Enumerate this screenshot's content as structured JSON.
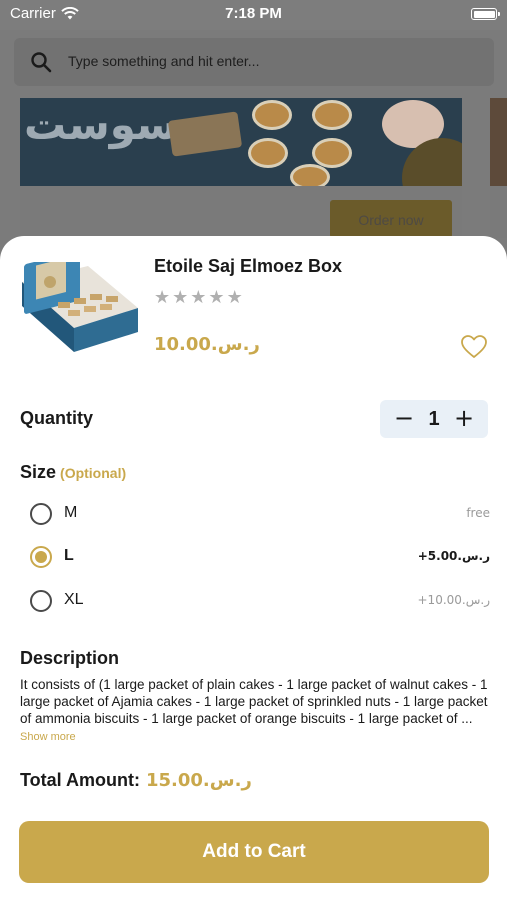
{
  "status_bar": {
    "carrier": "Carrier",
    "time": "7:18 PM"
  },
  "search": {
    "placeholder": "Type something and hit enter..."
  },
  "background": {
    "order_button": "Order now"
  },
  "product": {
    "title": "Etoile Saj Elmoez Box",
    "rating_stars": 5,
    "price": "10.00.ر.س"
  },
  "quantity": {
    "label": "Quantity",
    "value": "1",
    "minus": "−",
    "plus": "+"
  },
  "size": {
    "label": "Size",
    "optional": "(Optional)",
    "options": [
      {
        "name": "M",
        "price": "free",
        "selected": false
      },
      {
        "name": "L",
        "price": "+5.00.ر.س",
        "selected": true
      },
      {
        "name": "XL",
        "price": "+10.00.ر.س",
        "selected": false
      }
    ]
  },
  "description": {
    "label": "Description",
    "text": "It consists of (1 large packet of plain cakes - 1 large packet of walnut cakes - 1 large packet of Ajamia cakes - 1 large packet of sprinkled nuts - 1 large packet of ammonia biscuits - 1 large packet of orange biscuits - 1 large packet of ... ",
    "show_more": "Show more"
  },
  "total": {
    "label": "Total Amount:",
    "amount": "15.00.ر.س"
  },
  "cta": {
    "label": "Add to Cart"
  },
  "colors": {
    "accent": "#c9a84c",
    "stepper_bg": "#e9f0f7",
    "overlay": "#7b7b7b"
  }
}
